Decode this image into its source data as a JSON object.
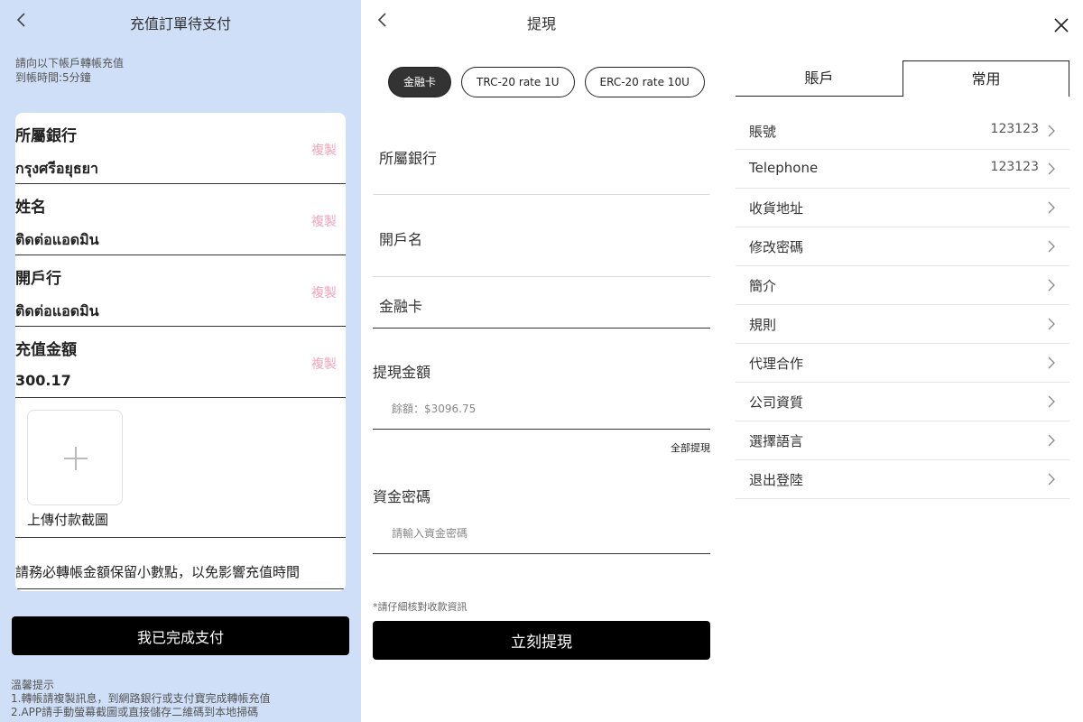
{
  "recharge": {
    "title": "充值訂單待支付",
    "intro_line1": "請向以下帳戶轉帳充值",
    "intro_line2": "到帳時間:5分鐘",
    "copy_label": "複製",
    "fields": [
      {
        "label": "所屬銀行",
        "value": "กรุงศรีอยุธยา"
      },
      {
        "label": "姓名",
        "value": "ติดต่อแอดมิน"
      },
      {
        "label": "開戶行",
        "value": "ติดต่อแอดมิน"
      },
      {
        "label": "充值金額",
        "value": "300.17"
      }
    ],
    "upload_label": "上傳付款截圖",
    "note": "請務必轉帳金額保留小數點，以免影響充值時間",
    "done_button": "我已完成支付",
    "tips_title": "溫馨提示",
    "tips_1": "1.轉帳請複製訊息，到網路銀行或支付寶完成轉帳充值",
    "tips_2": "2.APP請手動螢幕截圖或直接儲存二維碼到本地掃碼"
  },
  "withdraw": {
    "title": "提現",
    "tabs": [
      "金融卡",
      "TRC-20 rate 1U",
      "ERC-20 rate 10U"
    ],
    "bank_label": "所屬銀行",
    "name_label": "開戶名",
    "card_label": "金融卡",
    "amount_label": "提現金額",
    "balance_hint": "餘額：$3096.75",
    "all_button": "全部提現",
    "password_label": "資金密碼",
    "password_placeholder": "請輸入資金密碼",
    "warning": "*請仔細核對收款資訊",
    "submit_button": "立刻提現"
  },
  "account": {
    "tab_account": "賬戶",
    "tab_common": "常用",
    "items": [
      {
        "label": "賬號",
        "value": "123123"
      },
      {
        "label": "Telephone",
        "value": "123123"
      },
      {
        "label": "收貨地址"
      },
      {
        "label": "修改密碼"
      },
      {
        "label": "簡介"
      },
      {
        "label": "規則"
      },
      {
        "label": "代理合作"
      },
      {
        "label": "公司資質"
      },
      {
        "label": "選擇語言"
      },
      {
        "label": "退出登陸"
      }
    ]
  }
}
